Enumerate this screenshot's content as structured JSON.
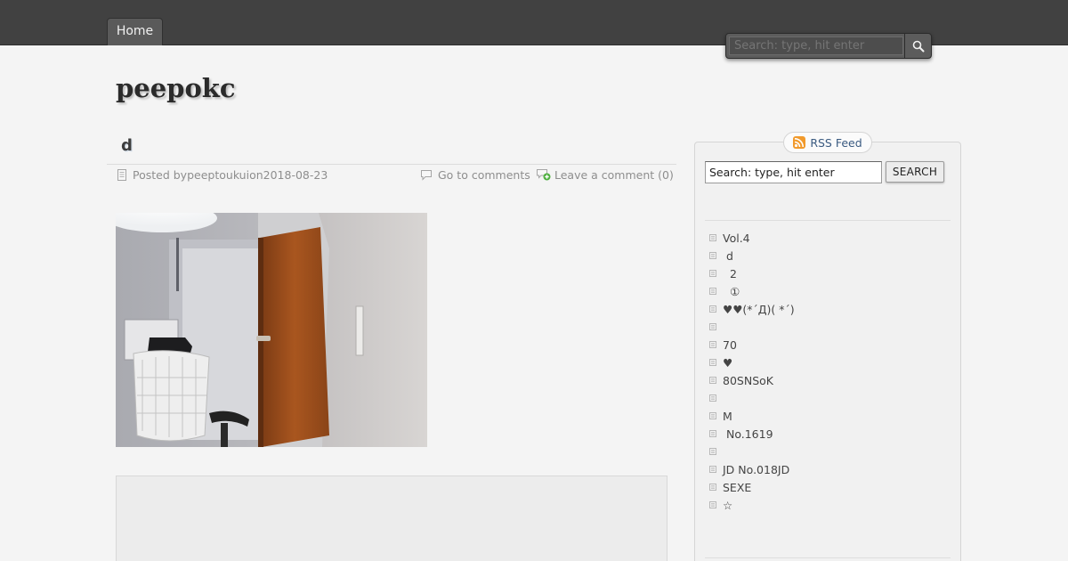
{
  "nav": {
    "home": "Home"
  },
  "top_search": {
    "placeholder": "Search: type, hit enter"
  },
  "site": {
    "title": "peepokc"
  },
  "post": {
    "title": "d",
    "posted_by_prefix": "Posted by ",
    "author": "peeptoukui",
    "on": " on ",
    "date": "2018-08-23",
    "go_to_comments": "Go to comments",
    "leave_comment": "Leave a comment (0)"
  },
  "sidebar": {
    "rss_label": "RSS Feed",
    "search_placeholder": "Search: type, hit enter",
    "search_button": "SEARCH",
    "recent_posts": [
      "Vol.4",
      " d",
      "  2",
      "  ①",
      "♥♥(*´Д)( *´)",
      "",
      "70",
      "♥",
      "80SNSoK",
      "",
      "M",
      " No.1619",
      "",
      "JD No.018JD",
      "SEXE",
      "☆"
    ]
  },
  "colors": {
    "topbar": "#414141",
    "background": "#f4f4f4",
    "link": "#3a5a80",
    "meta_text": "#8e8e8e"
  },
  "icons": {
    "search": "magnifier-icon",
    "post_meta": "document-icon",
    "comments": "speech-bubble-icon",
    "leave_comment": "add-comment-icon",
    "rss": "rss-icon",
    "bullet": "square-bullet-icon"
  }
}
